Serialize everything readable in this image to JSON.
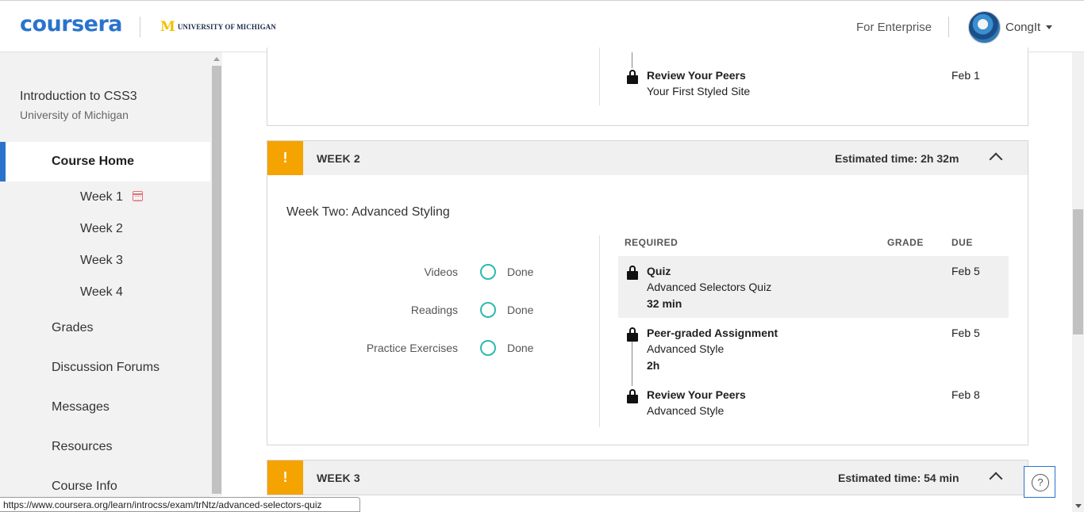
{
  "header": {
    "logo": "coursera",
    "partner_mark": "M",
    "partner_text": "UNIVERSITY OF MICHIGAN",
    "enterprise_link": "For Enterprise",
    "username": "CongIt"
  },
  "sidebar": {
    "course_title": "Introduction to CSS3",
    "course_org": "University of Michigan",
    "active_item": "Course Home",
    "weeks": [
      "Week 1",
      "Week 2",
      "Week 3",
      "Week 4"
    ],
    "items": [
      "Grades",
      "Discussion Forums",
      "Messages",
      "Resources",
      "Course Info"
    ]
  },
  "week1_tail": {
    "title": "Review Your Peers",
    "subtitle": "Your First Styled Site",
    "due": "Feb 1"
  },
  "week2": {
    "badge": "!",
    "label": "WEEK 2",
    "estimated": "Estimated time: 2h 32m",
    "module_title": "Week Two: Advanced Styling",
    "progress": [
      {
        "label": "Videos",
        "status": "Done"
      },
      {
        "label": "Readings",
        "status": "Done"
      },
      {
        "label": "Practice Exercises",
        "status": "Done"
      }
    ],
    "columns": {
      "required": "REQUIRED",
      "grade": "GRADE",
      "due": "DUE"
    },
    "items": [
      {
        "title": "Quiz",
        "subtitle": "Advanced Selectors Quiz",
        "duration": "32 min",
        "due": "Feb 5"
      },
      {
        "title": "Peer-graded Assignment",
        "subtitle": "Advanced Style",
        "duration": "2h",
        "due": "Feb 5"
      },
      {
        "title": "Review Your Peers",
        "subtitle": "Advanced Style",
        "due": "Feb 8"
      }
    ]
  },
  "week3": {
    "badge": "!",
    "label": "WEEK 3",
    "estimated": "Estimated time: 54 min"
  },
  "help": "?",
  "status_url": "https://www.coursera.org/learn/introcss/exam/trNtz/advanced-selectors-quiz",
  "colors": {
    "brand": "#2a73cc",
    "warning": "#f4a300",
    "progress": "#2bbbad"
  }
}
